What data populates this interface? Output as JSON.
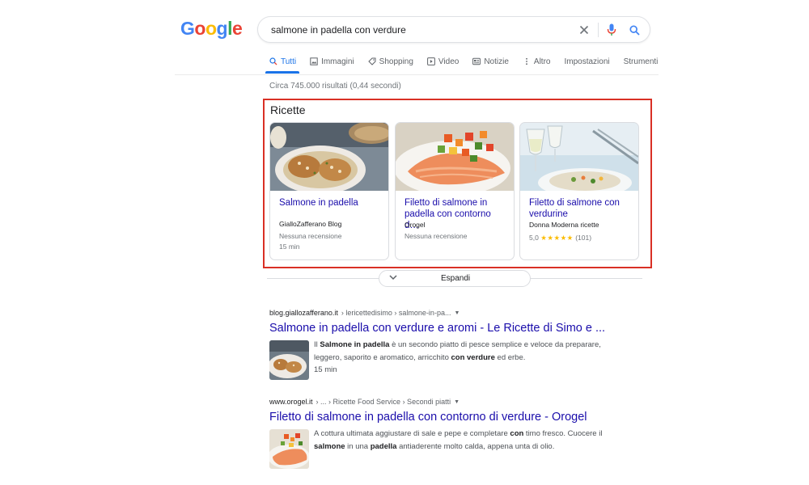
{
  "logo": {
    "text": "Google"
  },
  "search": {
    "query": "salmone in padella con verdure"
  },
  "tabs": [
    {
      "label": "Tutti",
      "icon": "search-icon"
    },
    {
      "label": "Immagini",
      "icon": "image-icon"
    },
    {
      "label": "Shopping",
      "icon": "tag-icon"
    },
    {
      "label": "Video",
      "icon": "play-icon"
    },
    {
      "label": "Notizie",
      "icon": "news-icon"
    },
    {
      "label": "Altro",
      "icon": "more-vert-icon"
    },
    {
      "label": "Impostazioni"
    },
    {
      "label": "Strumenti"
    }
  ],
  "stats": "Circa 745.000 risultati (0,44 secondi)",
  "recipes": {
    "heading": "Ricette",
    "cards": [
      {
        "title": "Salmone in padella",
        "source": "GialloZafferano Blog",
        "meta1": "Nessuna recensione",
        "meta2": "15 min"
      },
      {
        "title": "Filetto di salmone in padella con contorno d…",
        "source": "Orogel",
        "meta1": "Nessuna recensione"
      },
      {
        "title": "Filetto di salmone con verdurine",
        "source": "Donna Moderna ricette",
        "rating": "5,0",
        "stars": "★★★★★",
        "reviews": "(101)"
      }
    ],
    "expand_label": "Espandi"
  },
  "results": [
    {
      "domain": "blog.giallozafferano.it",
      "path": "› lericettedisimo › salmone-in-pa...",
      "title": "Salmone in padella con verdure e aromi - Le Ricette di Simo e ...",
      "snippet_parts": [
        "Il ",
        "Salmone in padella",
        " è un secondo piatto di pesce semplice e veloce da preparare, leggero, saporito e aromatico, arricchito ",
        "con verdure",
        " ed erbe."
      ],
      "extra": "15 min"
    },
    {
      "domain": "www.orogel.it",
      "path": "› ... › Ricette Food Service › Secondi piatti",
      "title": "Filetto di salmone in padella con contorno di verdure - Orogel",
      "snippet_parts": [
        "A cottura ultimata aggiustare di sale e pepe e completare ",
        "con",
        " timo fresco. Cuocere il ",
        "salmone",
        " in una ",
        "padella",
        " antiaderente molto calda, appena unta di olio."
      ]
    }
  ]
}
